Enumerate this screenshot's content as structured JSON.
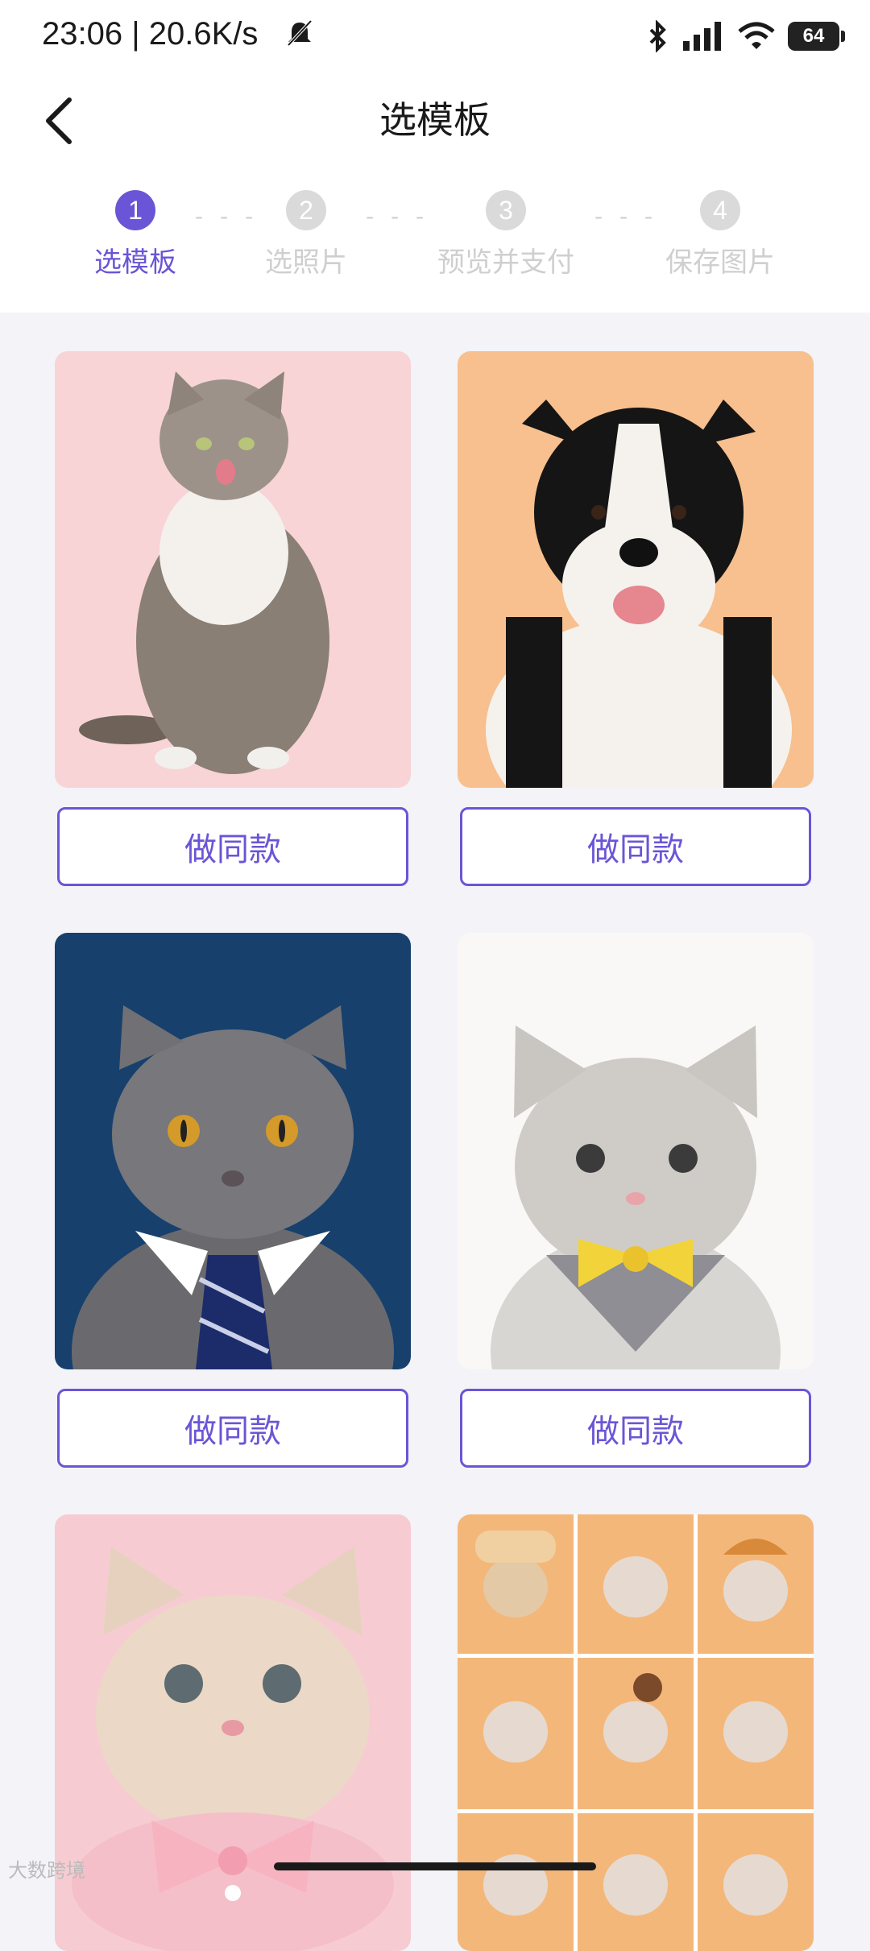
{
  "status_bar": {
    "time": "23:06 | 20.6K/s",
    "battery": "64"
  },
  "header": {
    "title": "选模板"
  },
  "steps": [
    {
      "number": "1",
      "label": "选模板"
    },
    {
      "number": "2",
      "label": "选照片"
    },
    {
      "number": "3",
      "label": "预览并支付"
    },
    {
      "number": "4",
      "label": "保存图片"
    }
  ],
  "templates": [
    {
      "button_label": "做同款"
    },
    {
      "button_label": "做同款"
    },
    {
      "button_label": "做同款"
    },
    {
      "button_label": "做同款"
    }
  ],
  "watermark": "大数跨境",
  "colors": {
    "accent": "#6A55D6",
    "background": "#F3F3F8"
  }
}
